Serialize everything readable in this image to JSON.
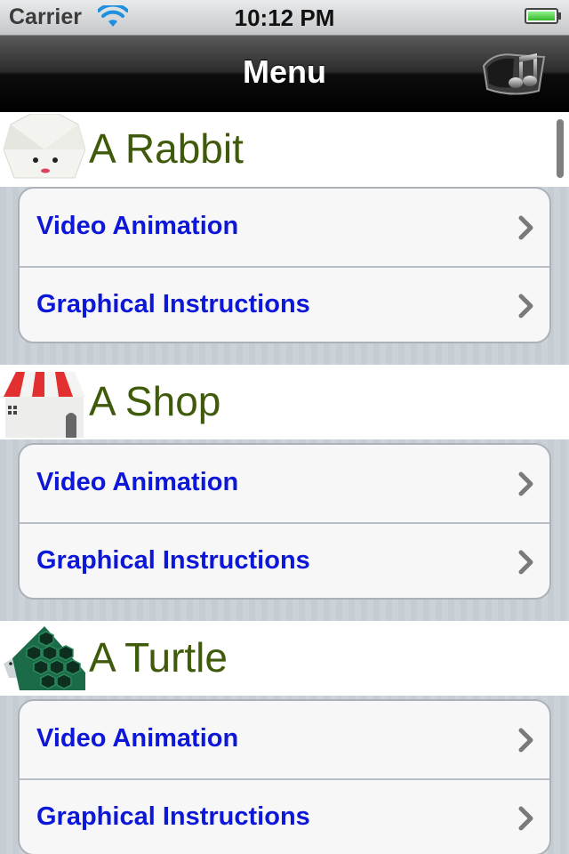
{
  "status_bar": {
    "carrier": "Carrier",
    "time": "10:12 PM",
    "battery_level": 0.9,
    "battery_color": "#36b82b"
  },
  "nav": {
    "title": "Menu",
    "right_button_icon": "music-note-icon"
  },
  "sections": [
    {
      "title": "A Rabbit",
      "icon": "rabbit-icon",
      "rows": [
        {
          "label": "Video Animation",
          "accessory": "chevron-right-icon"
        },
        {
          "label": "Graphical Instructions",
          "accessory": "chevron-right-icon"
        }
      ]
    },
    {
      "title": "A Shop",
      "icon": "shop-icon",
      "rows": [
        {
          "label": "Video Animation",
          "accessory": "chevron-right-icon"
        },
        {
          "label": "Graphical Instructions",
          "accessory": "chevron-right-icon"
        }
      ]
    },
    {
      "title": "A Turtle",
      "icon": "turtle-icon",
      "rows": [
        {
          "label": "Video Animation",
          "accessory": "chevron-right-icon"
        },
        {
          "label": "Graphical Instructions",
          "accessory": "chevron-right-icon"
        }
      ]
    }
  ],
  "colors": {
    "section_title": "#3e5a0a",
    "row_label": "#0d17d8",
    "nav_bar": "#000000",
    "table_background": "#cbd2d8"
  }
}
